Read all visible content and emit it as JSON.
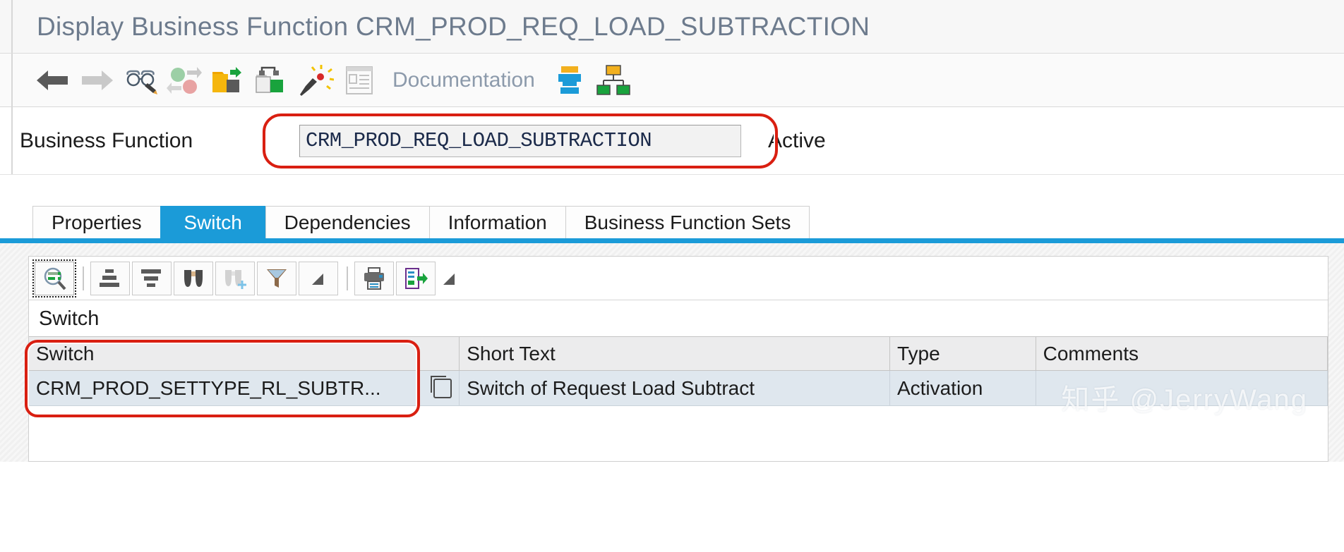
{
  "window": {
    "title": "Display Business Function CRM_PROD_REQ_LOAD_SUBTRACTION"
  },
  "toolbar": {
    "back_icon": "back-arrow-icon",
    "forward_icon": "forward-arrow-icon",
    "display_change_icon": "glasses-pencil-icon",
    "switch_framework_icon": "two-spheres-icon",
    "import_icon": "folder-import-icon",
    "export_icon": "folder-export-icon",
    "wizard_icon": "magic-wand-icon",
    "document_icon": "document-icon",
    "documentation_label": "Documentation",
    "hierarchy_icon": "hierarchy-stack-icon",
    "org_chart_icon": "org-chart-icon"
  },
  "business_function": {
    "label": "Business Function",
    "value": "CRM_PROD_REQ_LOAD_SUBTRACTION",
    "status": "Active",
    "highlight_color": "#d91f11"
  },
  "tabs": {
    "items": [
      {
        "label": "Properties",
        "selected": false
      },
      {
        "label": "Switch",
        "selected": true
      },
      {
        "label": "Dependencies",
        "selected": false
      },
      {
        "label": "Information",
        "selected": false
      },
      {
        "label": "Business Function Sets",
        "selected": false
      }
    ],
    "selected_color": "#1b9bd8"
  },
  "alv_toolbar": {
    "buttons": [
      {
        "name": "detail-icon",
        "focused": true
      },
      {
        "name": "sort-ascending-icon",
        "focused": false
      },
      {
        "name": "sort-descending-icon",
        "focused": false
      },
      {
        "name": "find-icon",
        "focused": false
      },
      {
        "name": "find-next-icon",
        "focused": false,
        "disabled": true
      },
      {
        "name": "filter-icon",
        "focused": false
      },
      {
        "name": "print-icon",
        "focused": false
      },
      {
        "name": "export-icon",
        "focused": false
      }
    ]
  },
  "grid": {
    "section_title": "Switch",
    "columns": [
      "Switch",
      "Short Text",
      "Type",
      "Comments"
    ],
    "rows": [
      {
        "switch": "CRM_PROD_SETTYPE_RL_SUBTR...",
        "short_text": "Switch of Request Load Subtract",
        "type": "Activation",
        "comments": ""
      }
    ]
  },
  "watermark": {
    "text": "知乎 @JerryWang"
  }
}
